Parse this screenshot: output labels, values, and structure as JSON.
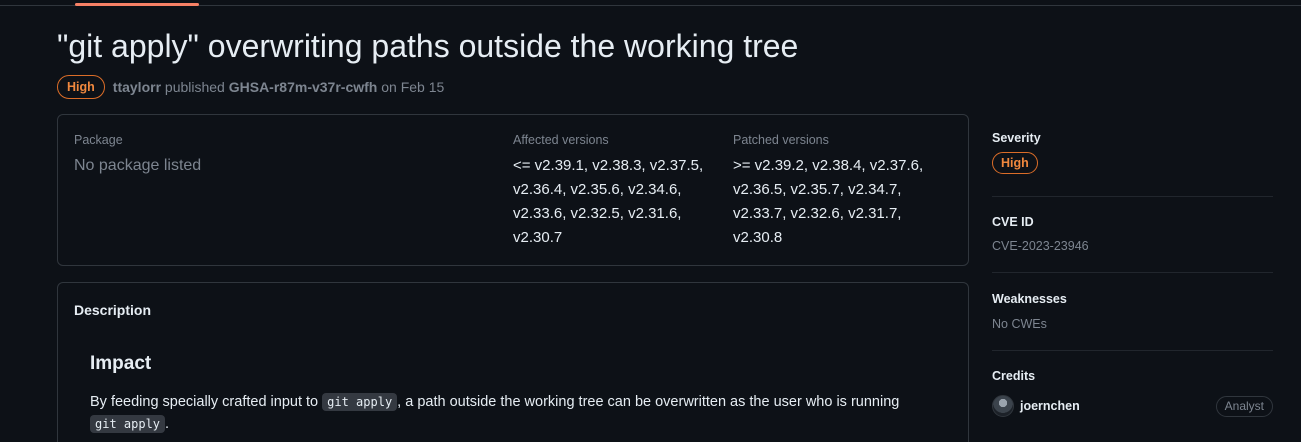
{
  "advisory": {
    "title": "\"git apply\" overwriting paths outside the working tree",
    "severity_badge": "High",
    "author": "ttaylorr",
    "published_word": "published",
    "ghsa_id": "GHSA-r87m-v37r-cwfh",
    "date_text": "on Feb 15"
  },
  "package_box": {
    "package_label": "Package",
    "package_value": "No package listed",
    "affected_label": "Affected versions",
    "affected_lines": [
      "<= v2.39.1, v2.38.3, v2.37.5,",
      "v2.36.4, v2.35.6, v2.34.6,",
      "v2.33.6, v2.32.5, v2.31.6,",
      "v2.30.7"
    ],
    "patched_label": "Patched versions",
    "patched_lines": [
      ">= v2.39.2, v2.38.4, v2.37.6,",
      "v2.36.5, v2.35.7, v2.34.7,",
      "v2.33.7, v2.32.6, v2.31.7,",
      "v2.30.8"
    ]
  },
  "description": {
    "title": "Description",
    "impact_heading": "Impact",
    "impact_text_1": "By feeding specially crafted input to ",
    "impact_code_1": "git apply",
    "impact_text_2": ", a path outside the working tree can be overwritten as the user who is running ",
    "impact_code_2": "git apply",
    "impact_text_3": "."
  },
  "sidebar": {
    "severity_label": "Severity",
    "severity_value": "High",
    "cve_label": "CVE ID",
    "cve_value": "CVE-2023-23946",
    "weaknesses_label": "Weaknesses",
    "weaknesses_value": "No CWEs",
    "credits_label": "Credits",
    "credits": [
      {
        "name": "joernchen",
        "role": "Analyst",
        "avatar_icon": "avatar"
      }
    ]
  },
  "colors": {
    "background": "#0d1117",
    "border": "#30363d",
    "severity_high": "#db6d28",
    "muted_text": "#7d8590",
    "tab_underline": "#f78166"
  }
}
